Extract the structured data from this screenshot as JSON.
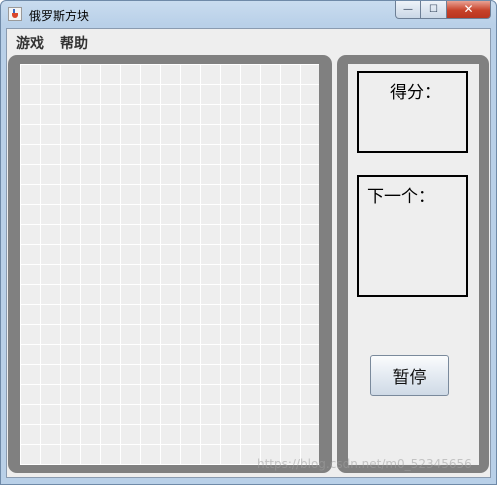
{
  "window": {
    "title": "俄罗斯方块",
    "minimize_glyph": "—",
    "maximize_glyph": "☐",
    "close_glyph": "✕"
  },
  "menu": {
    "items": [
      {
        "label": "游戏"
      },
      {
        "label": "帮助"
      }
    ]
  },
  "side": {
    "score_label": "得分：",
    "next_label": "下一个：",
    "pause_label": "暂停"
  },
  "watermark": "https://blog.csdn.net/m0_52345656",
  "colors": {
    "panel_frame": "#808080",
    "background": "#eeeeee",
    "grid_line": "#ffffff"
  },
  "icons": {
    "app": "java-cup-icon"
  }
}
